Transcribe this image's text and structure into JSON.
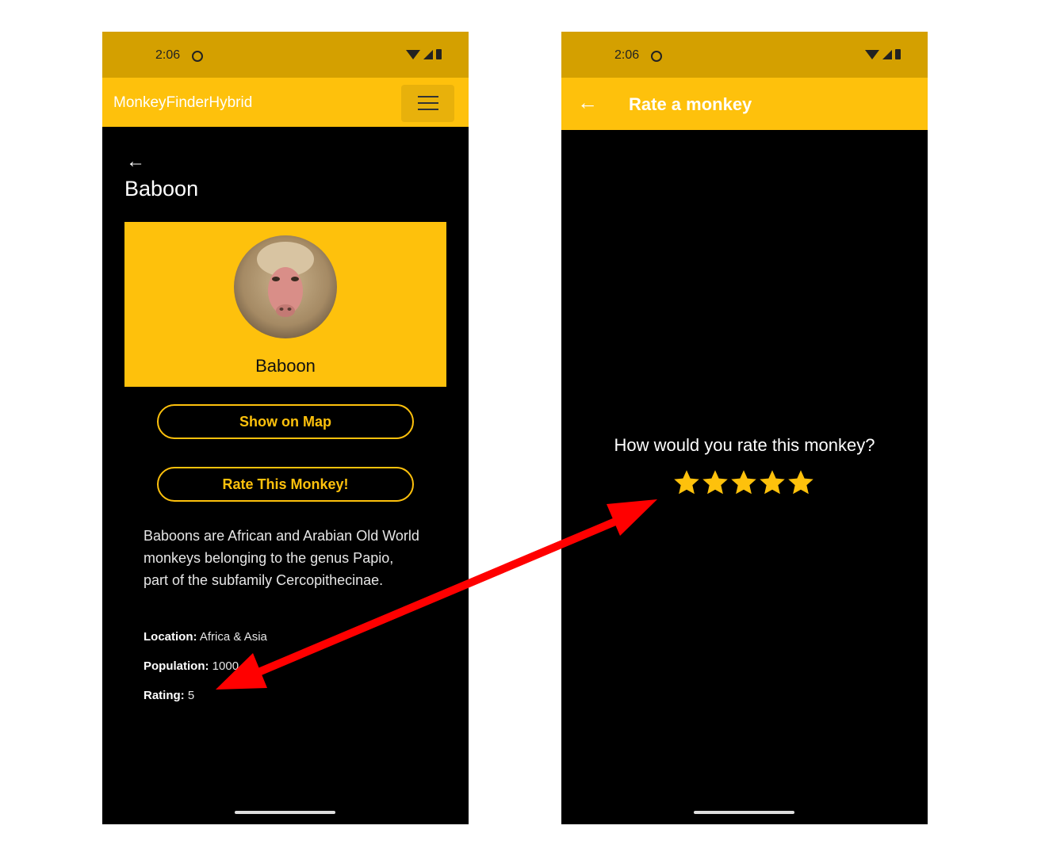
{
  "left_screen": {
    "status": {
      "time": "2:06"
    },
    "app_bar": {
      "title": "MonkeyFinderHybrid"
    },
    "detail": {
      "back_glyph": "←",
      "title": "Baboon",
      "card_name": "Baboon",
      "show_map_label": "Show on Map",
      "rate_label": "Rate This Monkey!",
      "description": "Baboons are African and Arabian Old World monkeys belonging to the genus Papio, part of the subfamily Cercopithecinae.",
      "location_label": "Location:",
      "location_value": "Africa & Asia",
      "population_label": "Population:",
      "population_value": "1000",
      "rating_label": "Rating:",
      "rating_value": "5"
    }
  },
  "right_screen": {
    "status": {
      "time": "2:06"
    },
    "app_bar": {
      "back_glyph": "←",
      "title": "Rate a monkey"
    },
    "question": "How would you rate this monkey?",
    "rating": {
      "value": 5,
      "max": 5
    }
  },
  "icons": [
    "wifi-icon",
    "signal-icon",
    "battery-icon",
    "menu-icon",
    "back-arrow-icon",
    "star-icon",
    "double-arrow-icon"
  ],
  "colors": {
    "accent": "#fec10c",
    "status_bar": "#d4a000",
    "background": "#000000",
    "annotation_arrow": "#ff0000"
  }
}
